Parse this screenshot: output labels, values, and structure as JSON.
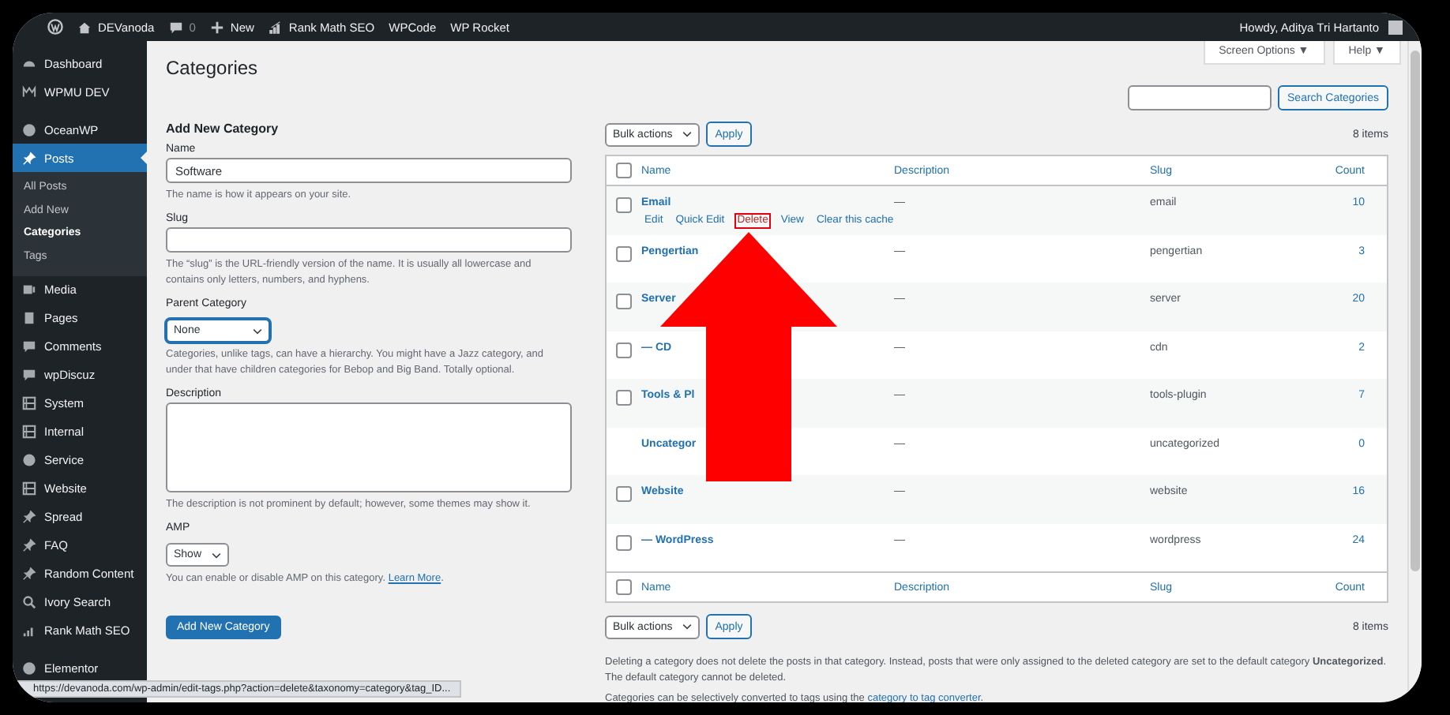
{
  "admin_bar": {
    "site": "DEVanoda",
    "comments": "0",
    "new": "New",
    "items": [
      {
        "label": "Rank Math SEO",
        "kind": "rankmath"
      },
      {
        "label": "WPCode",
        "kind": "plain"
      },
      {
        "label": "WP Rocket",
        "kind": "plain"
      }
    ],
    "greeting": "Howdy, Aditya Tri Hartanto"
  },
  "sidebar": {
    "groups": [
      [
        {
          "label": "Dashboard",
          "selected": false
        },
        {
          "label": "WPMU DEV",
          "selected": false
        }
      ],
      [
        {
          "label": "OceanWP",
          "selected": false
        },
        {
          "label": "Posts",
          "selected": true,
          "children": [
            {
              "label": "All Posts",
              "selected": false
            },
            {
              "label": "Add New",
              "selected": false
            },
            {
              "label": "Categories",
              "selected": true
            },
            {
              "label": "Tags",
              "selected": false
            }
          ]
        },
        {
          "label": "Media",
          "selected": false
        },
        {
          "label": "Pages",
          "selected": false
        },
        {
          "label": "Comments",
          "selected": false
        },
        {
          "label": "wpDiscuz",
          "selected": false
        },
        {
          "label": "System",
          "selected": false
        },
        {
          "label": "Internal",
          "selected": false
        },
        {
          "label": "Service",
          "selected": false
        },
        {
          "label": "Website",
          "selected": false
        },
        {
          "label": "Spread",
          "selected": false
        },
        {
          "label": "FAQ",
          "selected": false
        },
        {
          "label": "Random Content",
          "selected": false
        },
        {
          "label": "Ivory Search",
          "selected": false
        },
        {
          "label": "Rank Math SEO",
          "selected": false
        }
      ],
      [
        {
          "label": "Elementor",
          "selected": false
        }
      ]
    ]
  },
  "screen_tabs": [
    "Screen Options ▼",
    "Help ▼"
  ],
  "page_title": "Categories",
  "form": {
    "title": "Add New Category",
    "fields": [
      {
        "kind": "text",
        "label": "Name",
        "value": "Software",
        "focused": false,
        "hint": "The name is how it appears on your site."
      },
      {
        "kind": "text",
        "label": "Slug",
        "focused": false,
        "hint": "The “slug” is the URL-friendly version of the name. It is usually all lowercase and contains only letters, numbers, and hyphens."
      },
      {
        "kind": "select",
        "label": "Parent Category",
        "value": "None",
        "focused": true,
        "hint": "Categories, unlike tags, can have a hierarchy. You might have a Jazz category, and under that have children categories for Bebop and Big Band. Totally optional."
      },
      {
        "kind": "textarea",
        "label": "Description",
        "focused": false,
        "hint": "The description is not prominent by default; however, some themes may show it."
      },
      {
        "kind": "select",
        "label": "AMP",
        "value": "Show",
        "focused": false,
        "hint": "You can enable or disable AMP on this category.",
        "link": "Learn More",
        "link_after": "."
      }
    ],
    "submit": "Add New Category"
  },
  "search": {
    "button": "Search Categories"
  },
  "bulk_top": {
    "select": "Bulk actions",
    "apply": "Apply",
    "count": "8 items"
  },
  "table": {
    "header_checked": false,
    "footer_checked": false,
    "columns": [
      "Name",
      "Description",
      "Slug",
      "Count"
    ],
    "rows": [
      {
        "name": "Email",
        "description": "—",
        "slug": "email",
        "count": "10",
        "selectable": true,
        "checked": false,
        "actions": [
          {
            "label": "Edit",
            "kind": "normal",
            "highlighted": false
          },
          {
            "label": "Quick Edit",
            "kind": "normal",
            "highlighted": false
          },
          {
            "label": "Delete",
            "kind": "delete",
            "highlighted": true
          },
          {
            "label": "View",
            "kind": "normal",
            "highlighted": false
          },
          {
            "label": "Clear this cache",
            "kind": "normal",
            "highlighted": false
          }
        ]
      },
      {
        "name": "Pengertian",
        "description": "—",
        "slug": "pengertian",
        "count": "3",
        "selectable": true,
        "checked": false
      },
      {
        "name": "Server",
        "description": "—",
        "slug": "server",
        "count": "20",
        "selectable": true,
        "checked": false
      },
      {
        "name": "— CD",
        "description": "—",
        "slug": "cdn",
        "count": "2",
        "selectable": true,
        "checked": false
      },
      {
        "name": "Tools & Pl",
        "description": "—",
        "slug": "tools-plugin",
        "count": "7",
        "selectable": true,
        "checked": false
      },
      {
        "name": "Uncategor",
        "description": "—",
        "slug": "uncategorized",
        "count": "0",
        "selectable": false
      },
      {
        "name": "Website",
        "description": "—",
        "slug": "website",
        "count": "16",
        "selectable": true,
        "checked": false
      },
      {
        "name": "— WordPress",
        "description": "—",
        "slug": "wordpress",
        "count": "24",
        "selectable": true,
        "checked": false
      }
    ],
    "footer_columns": [
      "Name",
      "Description",
      "Slug",
      "Count"
    ]
  },
  "bulk_bottom": {
    "select": "Bulk actions",
    "apply": "Apply",
    "count": "8 items"
  },
  "notes": [
    {
      "text": "Deleting a category does not delete the posts in that category. Instead, posts that were only assigned to the deleted category are set to the default category **Uncategorized**. The default category cannot be deleted."
    },
    {
      "text": "Categories can be selectively converted to tags using the",
      "link": "category to tag converter",
      "link_after": "."
    }
  ],
  "status_url": "https://devanoda.com/wp-admin/edit-tags.php?action=delete&taxonomy=category&tag_ID..."
}
